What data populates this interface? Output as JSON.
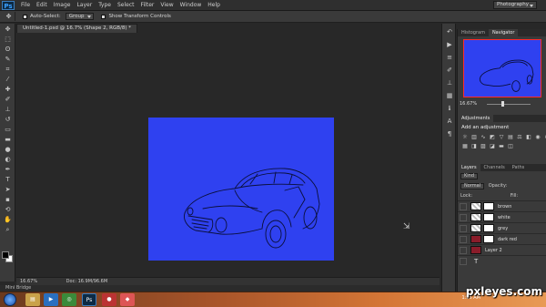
{
  "menubar": {
    "logo": "Ps",
    "items": [
      "File",
      "Edit",
      "Image",
      "Layer",
      "Type",
      "Select",
      "Filter",
      "View",
      "Window",
      "Help"
    ],
    "workspace": "Photography"
  },
  "options": {
    "auto_select_label": "Auto-Select:",
    "auto_select_value": "Group",
    "show_transform_label": "Show Transform Controls"
  },
  "document": {
    "tab_title": "Untitled-1.psd @ 16.7% (Shape 2, RGB/8) *",
    "zoom": "16.67%",
    "doc_size": "Doc: 16.9M/96.6M",
    "mini_bridge": "Mini Bridge"
  },
  "navigator": {
    "tabs": [
      "Histogram",
      "Navigator"
    ],
    "zoom": "16.67%"
  },
  "adjustments": {
    "tab": "Adjustments",
    "title": "Add an adjustment"
  },
  "layers": {
    "tabs": [
      "Layers",
      "Channels",
      "Paths"
    ],
    "kind": "Kind",
    "blend": "Normal",
    "opacity_label": "Opacity:",
    "lock_label": "Lock:",
    "fill_label": "Fill:",
    "rows": [
      {
        "name": "brown"
      },
      {
        "name": "white"
      },
      {
        "name": "grey"
      },
      {
        "name": "dark red"
      },
      {
        "name": "Layer 2"
      },
      {
        "name": "T"
      }
    ]
  },
  "taskbar": {
    "clock": "1:55 AM"
  },
  "watermark": "pxleyes.com",
  "colors": {
    "canvas_blue": "#2f41f0",
    "nav_border": "#ff2a2a",
    "ui_dark": "#282828"
  }
}
